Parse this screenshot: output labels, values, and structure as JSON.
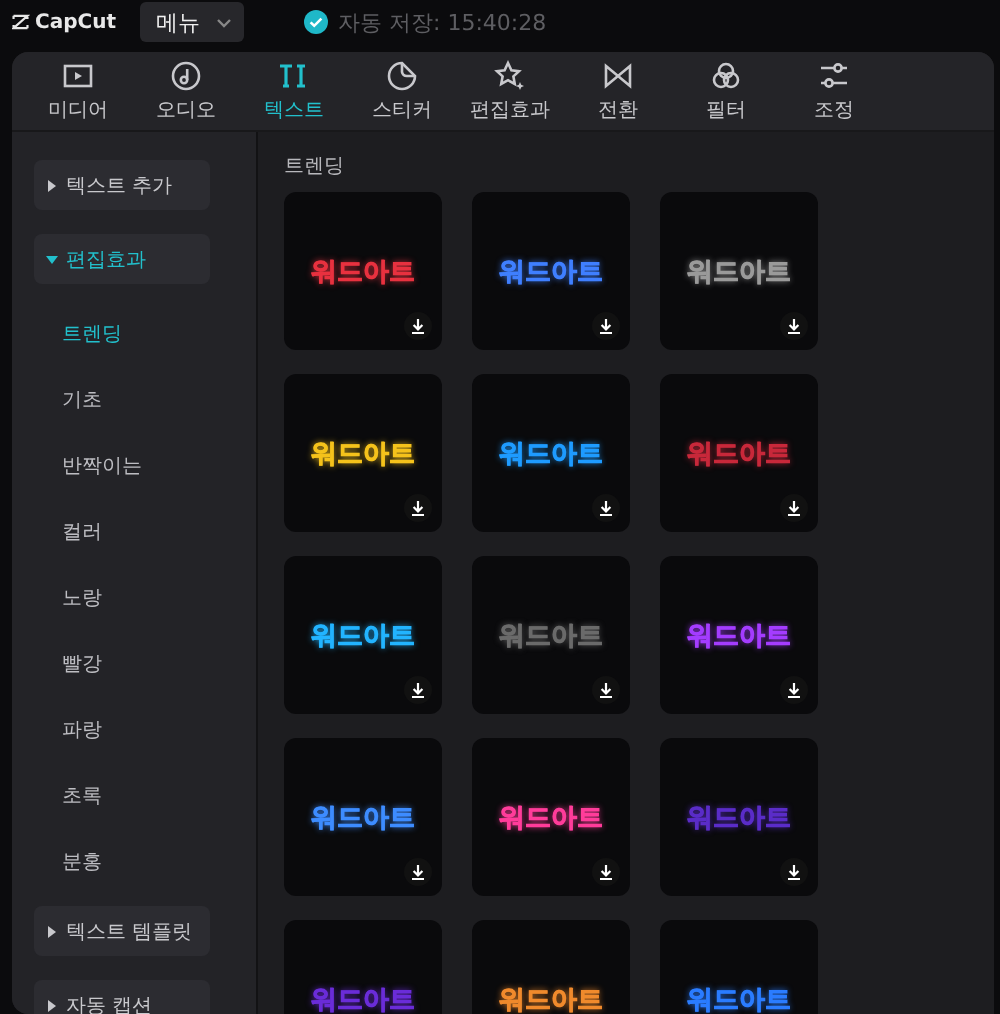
{
  "app": {
    "name": "CapCut",
    "menu_label": "메뉴",
    "autosave": "자동 저장: 15:40:28"
  },
  "tabs": [
    {
      "label": "미디어",
      "kind": "media",
      "selected": false
    },
    {
      "label": "오디오",
      "kind": "audio",
      "selected": false
    },
    {
      "label": "텍스트",
      "kind": "text",
      "selected": true
    },
    {
      "label": "스티커",
      "kind": "sticker",
      "selected": false
    },
    {
      "label": "편집효과",
      "kind": "effects",
      "selected": false
    },
    {
      "label": "전환",
      "kind": "transition",
      "selected": false
    },
    {
      "label": "필터",
      "kind": "filter",
      "selected": false
    },
    {
      "label": "조정",
      "kind": "adjust",
      "selected": false
    }
  ],
  "sidebar": [
    {
      "label": "텍스트 추가",
      "expanded": false,
      "selected": false
    },
    {
      "label": "편집효과",
      "expanded": true,
      "selected": true,
      "children": [
        {
          "label": "트렌딩",
          "selected": true
        },
        {
          "label": "기초",
          "selected": false
        },
        {
          "label": "반짝이는",
          "selected": false
        },
        {
          "label": "컬러",
          "selected": false
        },
        {
          "label": "노랑",
          "selected": false
        },
        {
          "label": "빨강",
          "selected": false
        },
        {
          "label": "파랑",
          "selected": false
        },
        {
          "label": "초록",
          "selected": false
        },
        {
          "label": "분홍",
          "selected": false
        }
      ]
    },
    {
      "label": "텍스트 템플릿",
      "expanded": false,
      "selected": false
    },
    {
      "label": "자동 캡션",
      "expanded": false,
      "selected": false
    }
  ],
  "section_title": "트렌딩",
  "presets": [
    {
      "text": "워드아트",
      "color": "#e8313f"
    },
    {
      "text": "워드아트",
      "color": "#3f7fff"
    },
    {
      "text": "워드아트",
      "color": "#9a9a9a"
    },
    {
      "text": "워드아트",
      "color": "#f5c21b"
    },
    {
      "text": "워드아트",
      "color": "#1e9bff"
    },
    {
      "text": "워드아트",
      "color": "#c8283a"
    },
    {
      "text": "워드아트",
      "color": "#22b4ff"
    },
    {
      "text": "워드아트",
      "color": "#6a6a6a"
    },
    {
      "text": "워드아트",
      "color": "#a43cff"
    },
    {
      "text": "워드아트",
      "color": "#3d8cff"
    },
    {
      "text": "워드아트",
      "color": "#ff3c9a"
    },
    {
      "text": "워드아트",
      "color": "#5a2cc8"
    },
    {
      "text": "워드아트",
      "color": "#6a2cd8"
    },
    {
      "text": "워드아트",
      "color": "#f08a2c"
    },
    {
      "text": "워드아트",
      "color": "#2a7cff"
    }
  ]
}
